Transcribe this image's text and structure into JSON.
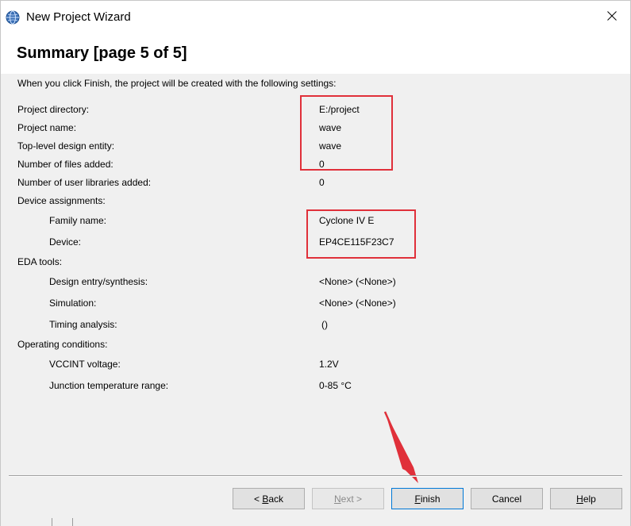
{
  "window": {
    "title": "New Project Wizard"
  },
  "heading": "Summary [page 5 of 5]",
  "intro": "When you click Finish, the project will be created with the following settings:",
  "rows": [
    {
      "label": "Project directory:",
      "value": "E:/project"
    },
    {
      "label": "Project name:",
      "value": "wave"
    },
    {
      "label": "Top-level design entity:",
      "value": "wave"
    },
    {
      "label": "Number of files added:",
      "value": "0"
    },
    {
      "label": "Number of user libraries added:",
      "value": "0"
    },
    {
      "label": "Device assignments:",
      "value": ""
    },
    {
      "label": "Family name:",
      "value": "Cyclone IV E"
    },
    {
      "label": "Device:",
      "value": "EP4CE115F23C7"
    },
    {
      "label": "EDA tools:",
      "value": ""
    },
    {
      "label": "Design entry/synthesis:",
      "value": "<None> (<None>)"
    },
    {
      "label": "Simulation:",
      "value": "<None> (<None>)"
    },
    {
      "label": "Timing analysis:",
      "value": "()"
    },
    {
      "label": "Operating conditions:",
      "value": ""
    },
    {
      "label": "VCCINT voltage:",
      "value": "1.2V"
    },
    {
      "label": "Junction temperature range:",
      "value": "0-85 °C"
    }
  ],
  "buttons": {
    "back": {
      "mnemonic": "B",
      "rest": "ack",
      "prefix": "< "
    },
    "next": {
      "mnemonic": "N",
      "rest": "ext >",
      "prefix": ""
    },
    "finish": {
      "mnemonic": "F",
      "rest": "inish",
      "prefix": ""
    },
    "cancel": {
      "label": "Cancel"
    },
    "help": {
      "mnemonic": "H",
      "rest": "elp",
      "prefix": ""
    }
  },
  "colors": {
    "highlight": "#e0303a",
    "default_button_border": "#0078d7"
  }
}
